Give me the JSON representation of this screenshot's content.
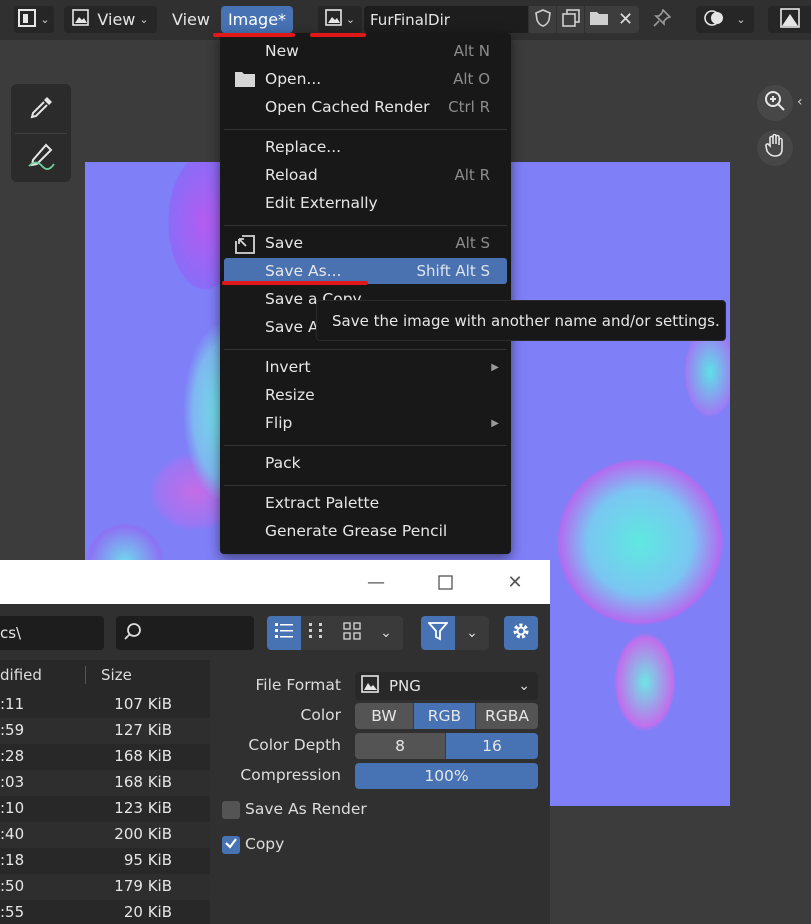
{
  "header": {
    "view_label": "View",
    "view_label_2": "View",
    "image_menu_label": "Image*",
    "image_name": "FurFinalDir"
  },
  "menu": {
    "items": [
      {
        "label": "New",
        "shortcut": "Alt N"
      },
      {
        "label": "Open...",
        "shortcut": "Alt O"
      },
      {
        "label": "Open Cached Render",
        "shortcut": "Ctrl R"
      },
      {
        "label": "Replace...",
        "shortcut": ""
      },
      {
        "label": "Reload",
        "shortcut": "Alt R"
      },
      {
        "label": "Edit Externally",
        "shortcut": ""
      },
      {
        "label": "Save",
        "shortcut": "Alt S"
      },
      {
        "label": "Save As...",
        "shortcut": "Shift Alt S"
      },
      {
        "label": "Save a Copy",
        "shortcut": ""
      },
      {
        "label": "Save A",
        "shortcut": ""
      },
      {
        "label": "Invert",
        "shortcut": ""
      },
      {
        "label": "Resize",
        "shortcut": ""
      },
      {
        "label": "Flip",
        "shortcut": ""
      },
      {
        "label": "Pack",
        "shortcut": ""
      },
      {
        "label": "Extract Palette",
        "shortcut": ""
      },
      {
        "label": "Generate Grease Pencil",
        "shortcut": ""
      }
    ]
  },
  "tooltip": "Save the image with another name and/or settings.",
  "dialog": {
    "path_fragment": "cs\\",
    "search_placeholder": "",
    "list_headers": {
      "modified": "dified",
      "size": "Size"
    },
    "files": [
      {
        "time": ":11",
        "size": "107 KiB"
      },
      {
        "time": ":59",
        "size": "127 KiB"
      },
      {
        "time": ":28",
        "size": "168 KiB"
      },
      {
        "time": ":03",
        "size": "168 KiB"
      },
      {
        "time": ":10",
        "size": "123 KiB"
      },
      {
        "time": ":40",
        "size": "200 KiB"
      },
      {
        "time": ":18",
        "size": "95 KiB"
      },
      {
        "time": ":50",
        "size": "179 KiB"
      },
      {
        "time": ":55",
        "size": "20 KiB"
      }
    ],
    "file_format_label": "File Format",
    "file_format_value": "PNG",
    "color_label": "Color",
    "color_options": [
      "BW",
      "RGB",
      "RGBA"
    ],
    "color_selected": "RGB",
    "depth_label": "Color Depth",
    "depth_options": [
      "8",
      "16"
    ],
    "depth_selected": "16",
    "compression_label": "Compression",
    "compression_value": "100%",
    "compression_fraction": 1.0,
    "save_as_render_label": "Save As Render",
    "save_as_render_checked": false,
    "copy_label": "Copy",
    "copy_checked": true
  },
  "colors": {
    "accent": "#4772b3",
    "annotation": "#e01818"
  }
}
